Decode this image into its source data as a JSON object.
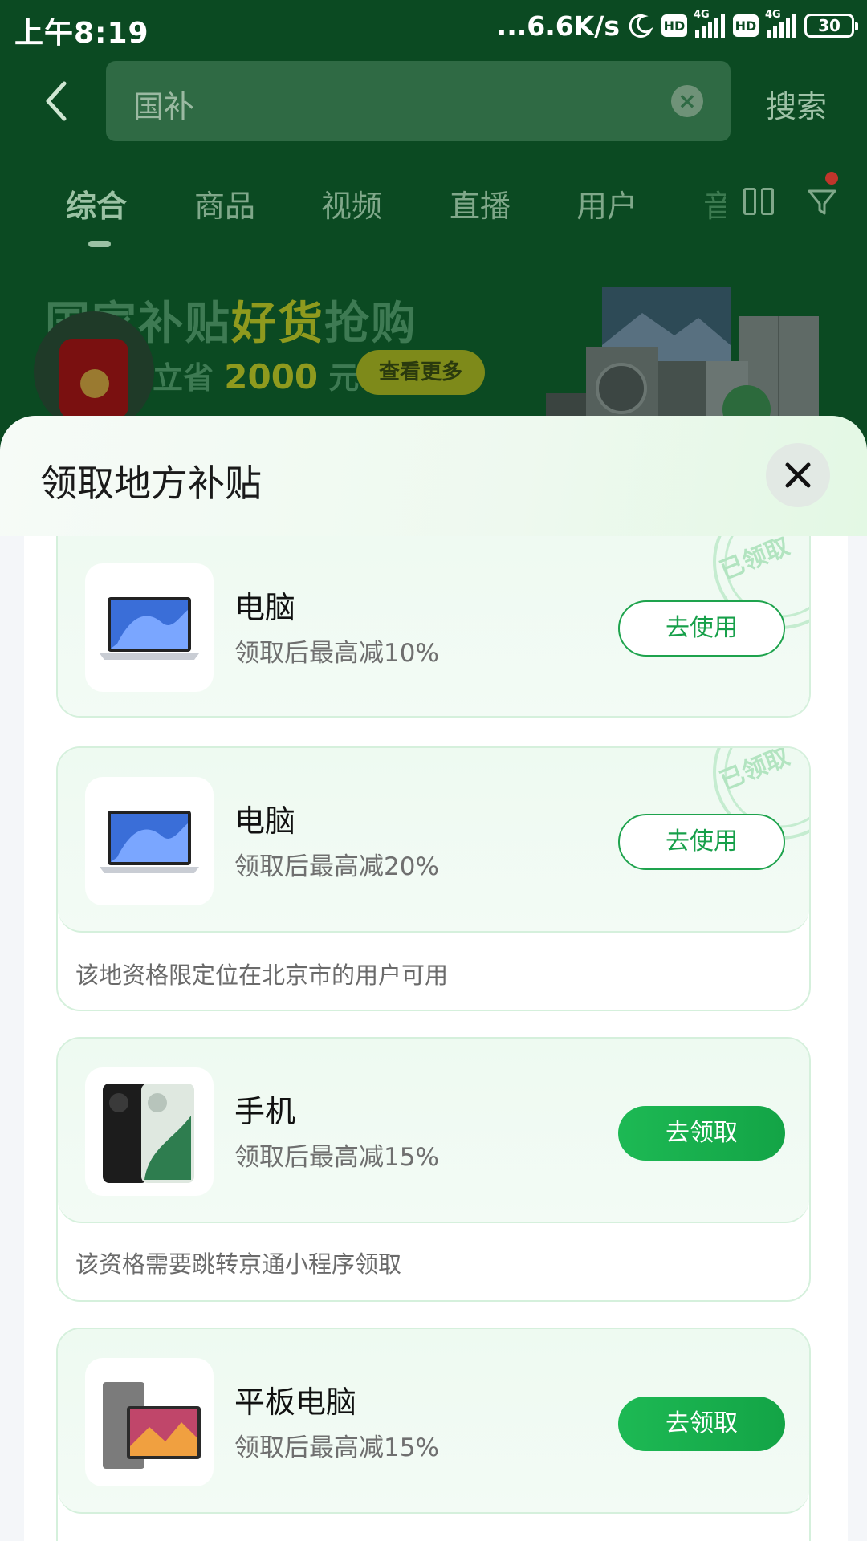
{
  "status_bar": {
    "time": "上午8:19",
    "speed": "...6.6K/s",
    "hd": "HD",
    "net": "4G",
    "battery": "30"
  },
  "search": {
    "query": "国补",
    "button_label": "搜索"
  },
  "tabs": [
    {
      "label": "综合",
      "active": true
    },
    {
      "label": "商品",
      "active": false
    },
    {
      "label": "视频",
      "active": false
    },
    {
      "label": "直播",
      "active": false
    },
    {
      "label": "用户",
      "active": false
    },
    {
      "label": "音",
      "active": false
    }
  ],
  "banner": {
    "title_part1": "国家补贴",
    "title_highlight": "好货",
    "title_part2": "抢购",
    "sub_prefix": "补",
    "sub_middle": "高立省",
    "sub_amount": "2000",
    "sub_unit": "元",
    "more_button": "查看更多"
  },
  "sheet": {
    "title": "领取地方补贴",
    "cards": [
      {
        "name": "电脑",
        "desc": "领取后最高减10%",
        "button": "去使用",
        "state": "claimed",
        "stamp": "已领取",
        "note": ""
      },
      {
        "name": "电脑",
        "desc": "领取后最高减20%",
        "button": "去使用",
        "state": "claimed",
        "stamp": "已领取",
        "note": "该地资格限定位在北京市的用户可用"
      },
      {
        "name": "手机",
        "desc": "领取后最高减15%",
        "button": "去领取",
        "state": "unclaimed",
        "note": "该资格需要跳转京通小程序领取"
      },
      {
        "name": "平板电脑",
        "desc": "领取后最高减15%",
        "button": "去领取",
        "state": "unclaimed",
        "note": ""
      }
    ]
  },
  "colors": {
    "accent_green": "#1db954",
    "bg_dark_green": "#0b4a22",
    "sheet_bg": "#f4f6f9"
  }
}
